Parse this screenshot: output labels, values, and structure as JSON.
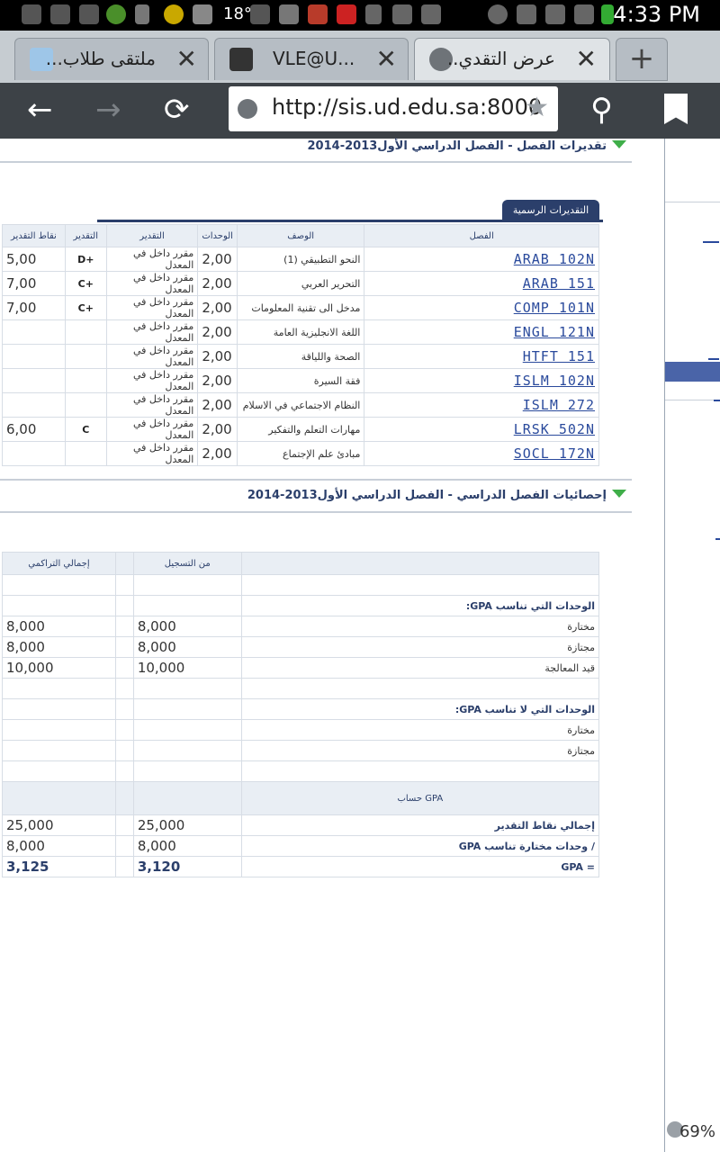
{
  "statusbar": {
    "time": "4:33 PM",
    "temp": "18°"
  },
  "tabs": [
    {
      "title": "ملتقى طلاب..."
    },
    {
      "title": "VLE@U..."
    },
    {
      "title": "عرض التقدي.."
    }
  ],
  "newtab": "+",
  "url": "http://sis.ud.edu.sa:8000",
  "section1_title": "تقديرات الفصل - الفصل الدراسي الأول2013-2014",
  "grades_tab": "التقديرات الرسمية",
  "grades_table": {
    "headers": [
      "نقاط التقدير",
      "التقدير",
      "التقدير",
      "الوحدات",
      "الوصف",
      "الفصل"
    ],
    "rows": [
      {
        "points": "5,00",
        "grade": "D+",
        "status": "مقرر داخل في المعدل",
        "units": "2,00",
        "desc": "النحو التطبيقي (1)",
        "course": "ARAB 102N"
      },
      {
        "points": "7,00",
        "grade": "C+",
        "status": "مقرر داخل في المعدل",
        "units": "2,00",
        "desc": "التحرير العربي",
        "course": "ARAB 151"
      },
      {
        "points": "7,00",
        "grade": "C+",
        "status": "مقرر داخل في المعدل",
        "units": "2,00",
        "desc": "مدخل الى تقنية المعلومات",
        "course": "COMP 101N"
      },
      {
        "points": "",
        "grade": "",
        "status": "مقرر داخل في المعدل",
        "units": "2,00",
        "desc": "اللغة الانجليزية العامة",
        "course": "ENGL 121N"
      },
      {
        "points": "",
        "grade": "",
        "status": "مقرر داخل في المعدل",
        "units": "2,00",
        "desc": "الصحة واللياقة",
        "course": "HTFT 151"
      },
      {
        "points": "",
        "grade": "",
        "status": "مقرر داخل في المعدل",
        "units": "2,00",
        "desc": "فقة السيرة",
        "course": "ISLM 102N"
      },
      {
        "points": "",
        "grade": "",
        "status": "مقرر داخل في المعدل",
        "units": "2,00",
        "desc": "النظام الاجتماعي في الاسلام",
        "course": "ISLM 272"
      },
      {
        "points": "6,00",
        "grade": "C",
        "status": "مقرر داخل في المعدل",
        "units": "2,00",
        "desc": "مهارات التعلم والتفكير",
        "course": "LRSK 502N"
      },
      {
        "points": "",
        "grade": "",
        "status": "مقرر داخل في المعدل",
        "units": "2,00",
        "desc": "مبادئ علم الإجتماع",
        "course": "SOCL 172N"
      }
    ]
  },
  "section2_title": "إحصائيات الفصل الدراسي - الفصل الدراسي الأول2013-2014",
  "stats": {
    "h_cum": "إجمالي التراكمي",
    "h_term": "من التسجيل",
    "gpa_units": "الوحدات التي تناسب GPA:",
    "attempted": "مختارة",
    "passed": "مجتازة",
    "in_progress": "قيد المعالجة",
    "nongpa_units": "الوحدات التي لا تناسب GPA:",
    "attempted2": "مختارة",
    "passed2": "مجتازة",
    "gpa_calc": "حساب GPA",
    "total_points": "إجمالي نقاط التقدير",
    "units_gpa": "/  وحدات مختارة تناسب GPA",
    "gpa_eq": "= GPA",
    "v": {
      "att_cum": "8,000",
      "att_term": "8,000",
      "pass_cum": "8,000",
      "pass_term": "8,000",
      "prog_cum": "10,000",
      "prog_term": "10,000",
      "tp_cum": "25,000",
      "tp_term": "25,000",
      "ug_cum": "8,000",
      "ug_term": "8,000",
      "gpa_cum": "3,125",
      "gpa_term": "3,120"
    }
  },
  "zoom": "69%"
}
